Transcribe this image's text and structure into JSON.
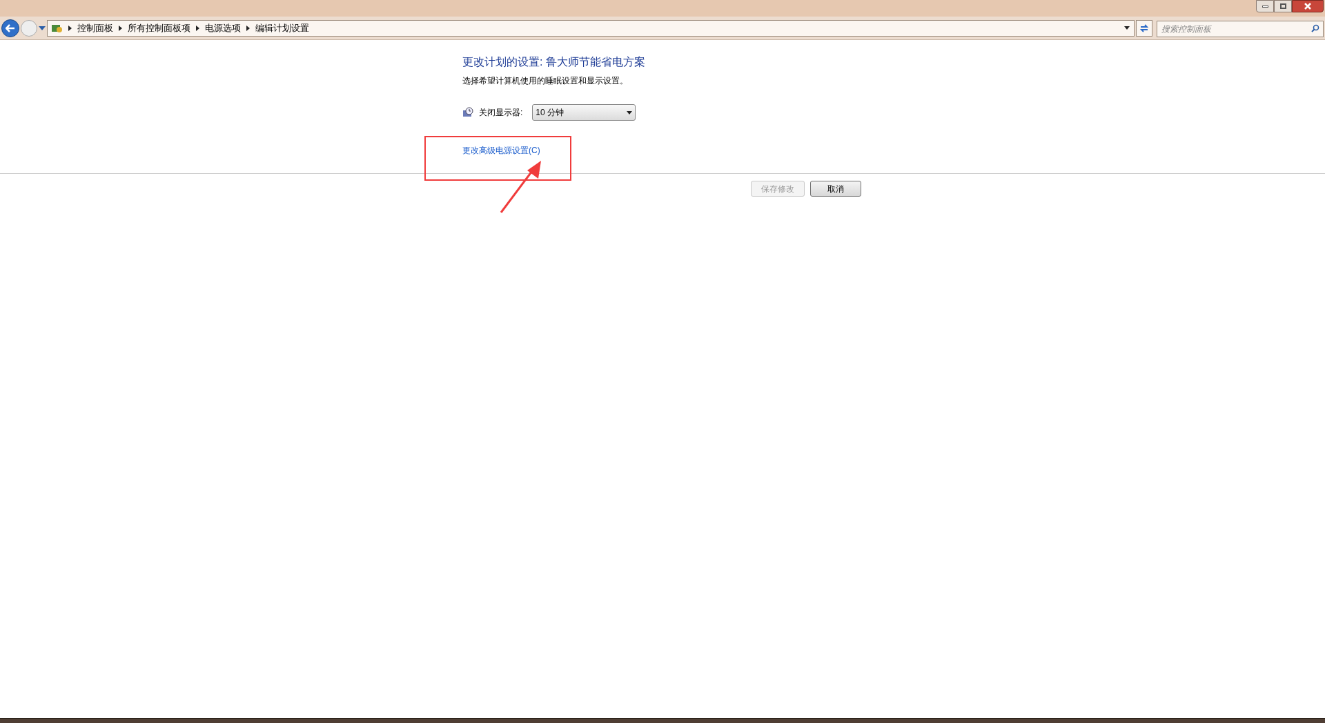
{
  "breadcrumb": [
    "控制面板",
    "所有控制面板项",
    "电源选项",
    "编辑计划设置"
  ],
  "search": {
    "placeholder": "搜索控制面板"
  },
  "heading": "更改计划的设置: 鲁大师节能省电方案",
  "description": "选择希望计算机使用的睡眠设置和显示设置。",
  "settings": [
    {
      "label": "关闭显示器:",
      "value": "10 分钟"
    }
  ],
  "advanced_link": "更改高级电源设置(C)",
  "buttons": [
    {
      "label": "保存修改",
      "disabled": true
    },
    {
      "label": "取消",
      "disabled": false
    }
  ]
}
